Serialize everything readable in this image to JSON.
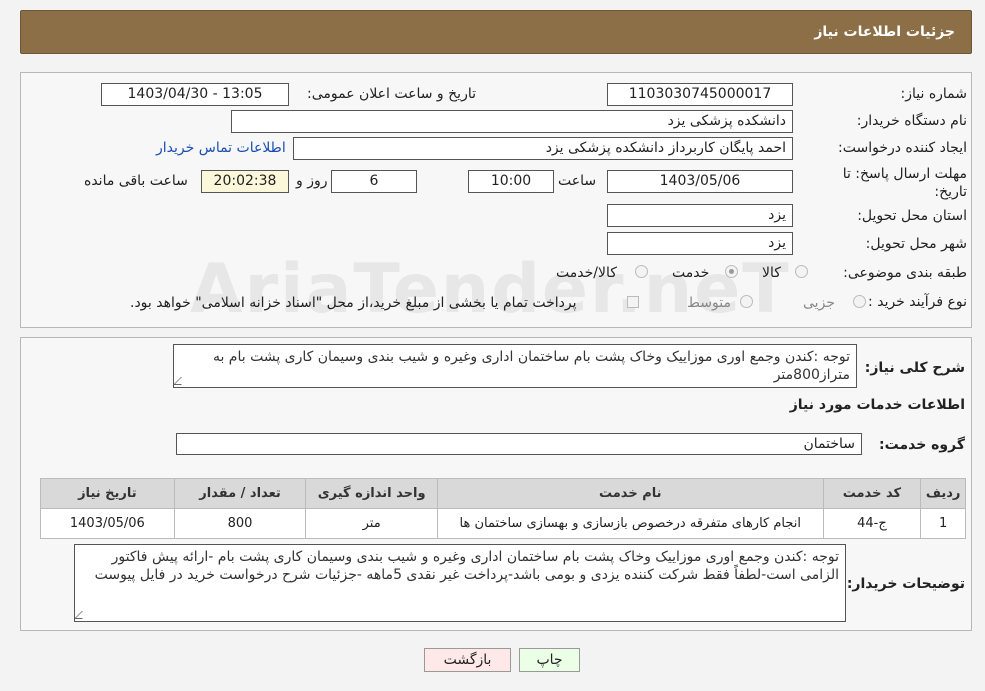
{
  "header": {
    "title": "جزئیات اطلاعات نیاز"
  },
  "watermark": {
    "text": "AriaTender.neT"
  },
  "form": {
    "need_number": {
      "label": "شماره نیاز:",
      "value": "1103030745000017"
    },
    "announce_datetime": {
      "label": "تاریخ و ساعت اعلان عمومی:",
      "value": "1403/04/30 - 13:05"
    },
    "buyer_org": {
      "label": "نام دستگاه خریدار:",
      "value": "دانشکده پزشکی  یزد"
    },
    "requester": {
      "label": "ایجاد کننده درخواست:",
      "value": "احمد پایگان کاربرداز دانشکده پزشکی  یزد",
      "contact_link": "اطلاعات تماس خریدار"
    },
    "deadline": {
      "label_line1": "مهلت ارسال پاسخ: تا",
      "label_line2": "تاریخ:",
      "date": "1403/05/06",
      "time_label": "ساعت",
      "time": "10:00",
      "days": "6",
      "days_label": "روز و",
      "remaining": "20:02:38",
      "remaining_label": "ساعت باقی مانده"
    },
    "province": {
      "label": "استان محل تحویل:",
      "value": "یزد"
    },
    "city": {
      "label": "شهر محل تحویل:",
      "value": "یزد"
    },
    "category": {
      "label": "طبقه بندی موضوعی:",
      "options": [
        "کالا",
        "خدمت",
        "کالا/خدمت"
      ],
      "selected": "خدمت"
    },
    "purchase_type": {
      "label": "نوع فرآیند خرید :",
      "options": [
        "جزیی",
        "متوسط"
      ],
      "note": "پرداخت تمام یا بخشی از مبلغ خرید،از محل \"اسناد خزانه اسلامی\" خواهد بود."
    }
  },
  "summary": {
    "label": "شرح کلی نیاز:",
    "value": "توجه :کندن وجمع اوری موزاییک وخاک پشت بام ساختمان اداری وغیره  و شیب بندی وسیمان کاری پشت بام به متراز800متر"
  },
  "services": {
    "section_title": "اطلاعات خدمات مورد نیاز",
    "group_label": "گروه خدمت:",
    "group_value": "ساختمان",
    "table": {
      "headers": [
        "ردیف",
        "کد خدمت",
        "نام خدمت",
        "واحد اندازه گیری",
        "تعداد / مقدار",
        "تاریخ نیاز"
      ],
      "rows": [
        [
          "1",
          "ج-44",
          "انجام کارهای متفرقه درخصوص بازسازی و بهسازی ساختمان ها",
          "متر",
          "800",
          "1403/05/06"
        ]
      ]
    }
  },
  "buyer_notes": {
    "label": "توضیحات خریدار:",
    "value": "توجه :کندن وجمع اوری موزاییک وخاک پشت بام ساختمان اداری وغیره  و شیب بندی وسیمان کاری پشت بام  -ارائه پیش فاکتور الزامی است-لطفاً فقط شرکت کننده یزدی و بومی باشد-پرداخت غیر نقدی 5ماهه -جزئیات شرح درخواست خرید در فایل پیوست"
  },
  "buttons": {
    "print": "چاپ",
    "back": "بازگشت"
  }
}
